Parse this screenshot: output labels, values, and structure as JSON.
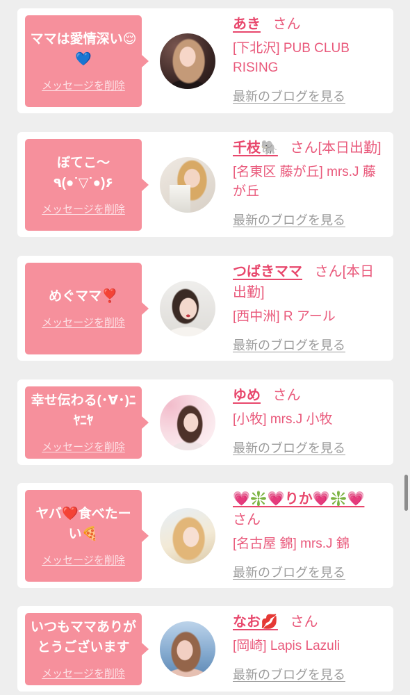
{
  "theme": {
    "page_background": "#eeeeee",
    "card_background": "#ffffff",
    "bubble": "#f6909c",
    "name": "#e8476c",
    "subtext": "#e9597b",
    "muted_link": "#9b9b9b",
    "delete_link": "#fde2e7",
    "scrollbar": "#8c8c8c"
  },
  "cards": [
    {
      "message": "ママは愛情深い😌💙",
      "delete_label": "メッセージを削除",
      "name": "あき",
      "honorific": "さん",
      "store": "[下北沢] PUB CLUB RISING",
      "blog_label": "最新のブログを見る"
    },
    {
      "message": "ぼてこ〜٩(●˙▽˙●)۶",
      "delete_label": "メッセージを削除",
      "name": "千枝🐘",
      "honorific": "さん",
      "status": "[本日出勤]",
      "store": "[名東区 藤が丘] mrs.J 藤が丘",
      "blog_label": "最新のブログを見る"
    },
    {
      "message": "めぐママ❣️",
      "delete_label": "メッセージを削除",
      "name": "つばきママ",
      "honorific": "さん",
      "status": "[本日出勤]",
      "store": "[西中洲] R アール",
      "blog_label": "最新のブログを見る"
    },
    {
      "message": "幸せ伝わる(･∀･)ﾆﾔﾆﾔ",
      "delete_label": "メッセージを削除",
      "name": "ゆめ",
      "honorific": "さん",
      "store": "[小牧] mrs.J 小牧",
      "blog_label": "最新のブログを見る"
    },
    {
      "message": "ヤバ❤️食べたーい🍕",
      "delete_label": "メッセージを削除",
      "name": "💗❇️💗りか💗❇️💗",
      "honorific": "さん",
      "store": "[名古屋 錦] mrs.J 錦",
      "blog_label": "最新のブログを見る"
    },
    {
      "message": "いつもママありがとうございます",
      "delete_label": "メッセージを削除",
      "name": "なお💋",
      "honorific": "さん",
      "store": "[岡崎] Lapis Lazuli",
      "blog_label": "最新のブログを見る"
    }
  ]
}
